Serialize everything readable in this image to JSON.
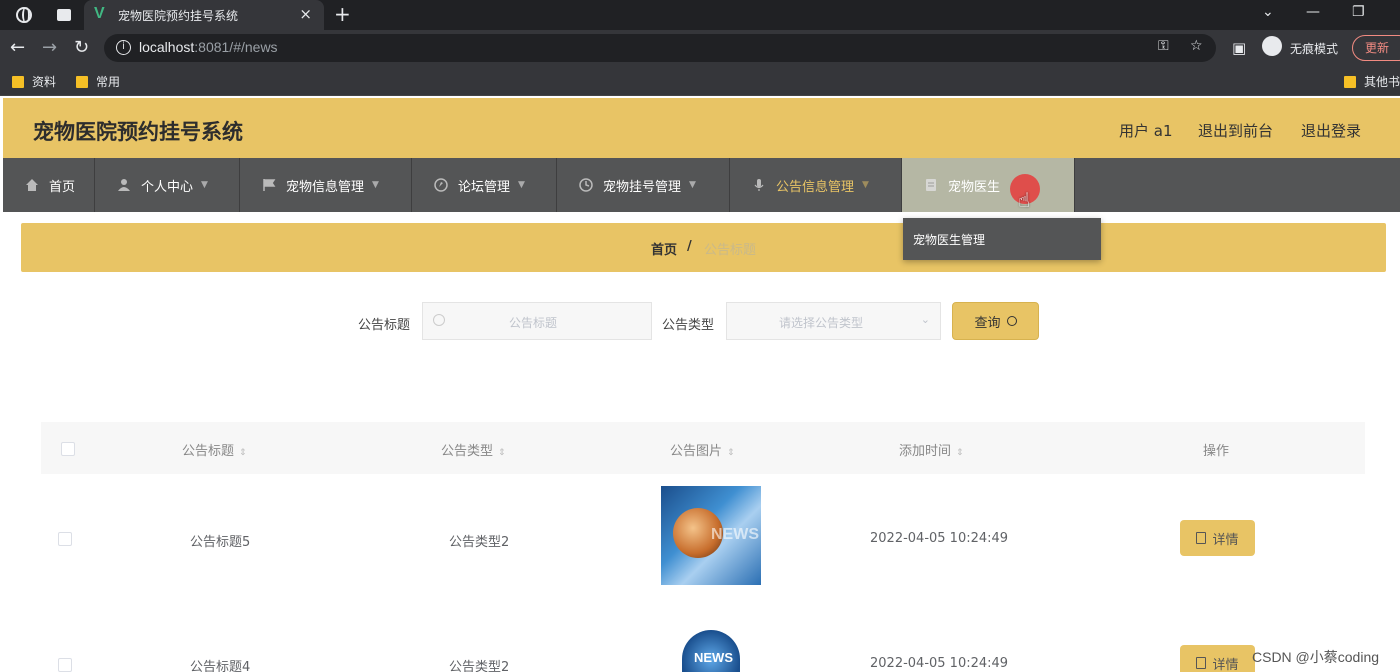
{
  "browser": {
    "tab_title": "宠物医院预约挂号系统",
    "tab_close": "×",
    "new_tab": "+",
    "url_host": "localhost",
    "url_rest": ":8081/#/news",
    "incognito_label": "无痕模式",
    "update_label": "更新",
    "bookmarks": [
      "资料",
      "常用",
      "其他书"
    ]
  },
  "header": {
    "title": "宠物医院预约挂号系统",
    "user": "用户 a1",
    "back_front": "退出到前台",
    "logout": "退出登录"
  },
  "nav": {
    "items": [
      {
        "label": "首页",
        "icon": "home-icon"
      },
      {
        "label": "个人中心",
        "icon": "user-icon"
      },
      {
        "label": "宠物信息管理",
        "icon": "flag-icon"
      },
      {
        "label": "论坛管理",
        "icon": "compass-icon"
      },
      {
        "label": "宠物挂号管理",
        "icon": "clock-icon"
      },
      {
        "label": "公告信息管理",
        "icon": "mic-icon"
      },
      {
        "label": "宠物医生",
        "icon": "document-icon"
      }
    ],
    "dropdown_item": "宠物医生管理"
  },
  "breadcrumb": {
    "home": "首页",
    "sep": "/",
    "current": "公告标题"
  },
  "search": {
    "title_label": "公告标题",
    "title_placeholder": "公告标题",
    "type_label": "公告类型",
    "type_placeholder": "请选择公告类型",
    "query_button": "查询"
  },
  "table": {
    "headers": [
      "公告标题",
      "公告类型",
      "公告图片",
      "添加时间",
      "操作"
    ],
    "rows": [
      {
        "title": "公告标题5",
        "type": "公告类型2",
        "time": "2022-04-05 10:24:49",
        "action": "详情"
      },
      {
        "title": "公告标题4",
        "type": "公告类型2",
        "time": "2022-04-05 10:24:49",
        "action": "详情"
      }
    ]
  },
  "watermark": "CSDN @小蔡coding",
  "colors": {
    "accent": "#e8c465",
    "navbar": "#545556"
  }
}
